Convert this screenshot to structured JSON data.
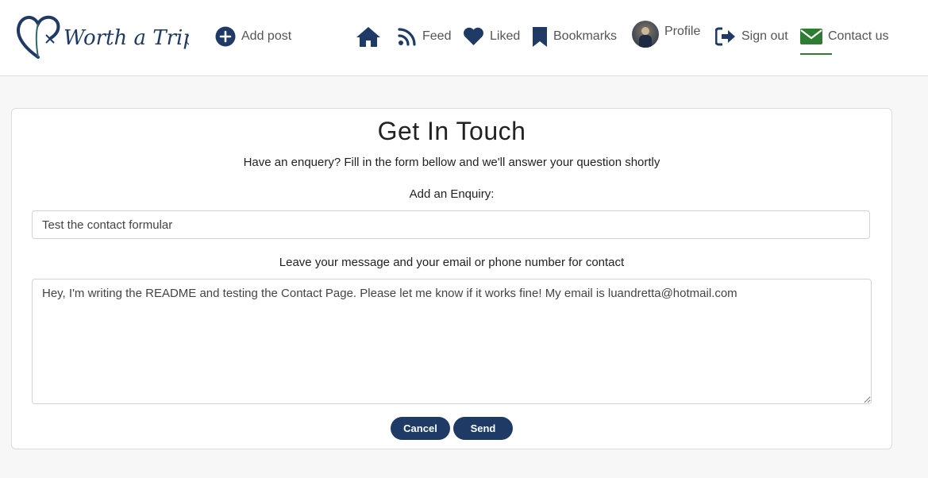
{
  "brand": {
    "name": "Worth a Trip",
    "color": "#1f3a64",
    "accent": "#2d6a6a"
  },
  "nav": {
    "add_post": "Add post",
    "home": "",
    "feed": "Feed",
    "liked": "Liked",
    "bookmarks": "Bookmarks",
    "profile": "Profile",
    "sign_out": "Sign out",
    "contact": "Contact us",
    "active_item": "contact",
    "icon_color": "#1f3a64",
    "active_color": "#2e7d32",
    "icons": {
      "add_post": "plus-circle-icon",
      "home": "home-icon",
      "feed": "rss-icon",
      "liked": "heart-icon",
      "bookmarks": "bookmark-icon",
      "sign_out": "sign-out-icon",
      "contact": "envelope-icon"
    }
  },
  "contact": {
    "title": "Get In Touch",
    "subtitle": "Have an enquery? Fill in the form bellow and we'll answer your question shortly",
    "enquiry_label": "Add an Enquiry:",
    "enquiry_value": "Test the contact formular",
    "message_label": "Leave your message and your email or phone number for contact",
    "message_value": "Hey, I'm writing the README and testing the Contact Page. Please let me know if it works fine! My email is luandretta@hotmail.com",
    "cancel_label": "Cancel",
    "send_label": "Send",
    "button_color": "#1f3a64"
  }
}
